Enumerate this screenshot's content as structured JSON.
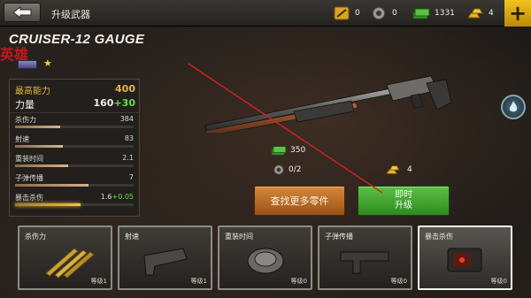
{
  "header": {
    "title": "升级武器",
    "resources": [
      {
        "name": "gold-bar-sack-icon",
        "value": "0"
      },
      {
        "name": "gear-part-icon",
        "value": "0"
      },
      {
        "name": "cash-stack-icon",
        "value": "1331"
      },
      {
        "name": "gold-bars-icon",
        "value": "4"
      }
    ],
    "plus_label": "+"
  },
  "weapon": {
    "name": "CRUISER-12 GAUGE",
    "hero_tag": "英雄",
    "rank_badge": "",
    "star": "★"
  },
  "stats": {
    "max_power_label": "最高能力",
    "max_power_value": "400",
    "power_label": "力量",
    "power_base": "160",
    "power_bonus": "+30",
    "rows": [
      {
        "label": "杀伤力",
        "value": "384",
        "bonus": "",
        "fill": 0.38
      },
      {
        "label": "射速",
        "value": "83",
        "bonus": "",
        "fill": 0.4
      },
      {
        "label": "重装时间",
        "value": "2.1",
        "bonus": "",
        "fill": 0.45
      },
      {
        "label": "子弹传播",
        "value": "7",
        "bonus": "",
        "fill": 0.62
      },
      {
        "label": "暴击杀伤",
        "value": "1.6",
        "bonus": "+0.05",
        "fill": 0.55
      }
    ]
  },
  "costs": {
    "cash": "350",
    "parts": "0/2",
    "gold": "4"
  },
  "buttons": {
    "find_parts": "查找更多零件",
    "upgrade_line1": "即时",
    "upgrade_line2": "升级"
  },
  "parts": [
    {
      "label": "杀伤力",
      "level": "等级1"
    },
    {
      "label": "射速",
      "level": "等级1"
    },
    {
      "label": "重装时间",
      "level": "等级0"
    },
    {
      "label": "子弹传播",
      "level": "等级0"
    },
    {
      "label": "暴击杀伤",
      "level": "等级0"
    }
  ],
  "colors": {
    "gold": "#e9b441",
    "green_bonus": "#5ee04a",
    "hero_red": "#c4161c",
    "upgrade_green": "#3ea52a",
    "find_orange": "#c2702a",
    "plus_yellow": "#f3c220"
  }
}
